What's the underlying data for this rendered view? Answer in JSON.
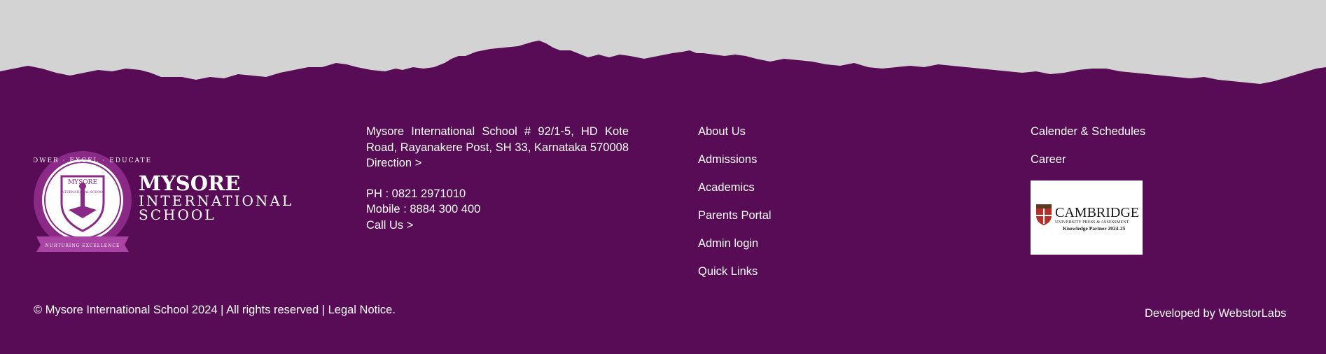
{
  "colors": {
    "footer_bg": "#580c56",
    "page_bg": "#d3d3d3",
    "text": "#ffffff"
  },
  "logo": {
    "name_line1": "MYSORE",
    "name_line2": "INTERNATIONAL",
    "name_line3": "SCHOOL",
    "emblem_top": "EMPOWER · EXCEL · EDUCATE",
    "emblem_shield_title": "MYSORE",
    "emblem_shield_subtitle": "INTERNATIONAL SCHOOL",
    "emblem_ribbon": "NURTURING EXCELLENCE"
  },
  "contact": {
    "address": "Mysore International School # 92/1-5, HD Kote Road, Rayanakere Post, SH 33, Karnataka 570008",
    "direction_link": "Direction >",
    "phone": "PH : 0821 2971010",
    "mobile": "Mobile : 8884 300 400",
    "call_link": "Call Us >"
  },
  "links_col1": [
    "About Us",
    "Admissions",
    "Academics",
    "Parents Portal",
    "Admin login",
    "Quick Links"
  ],
  "links_col2": [
    "Calender & Schedules",
    "Career"
  ],
  "partner": {
    "name": "CAMBRIDGE",
    "subtitle": "UNIVERSITY PRESS & ASSESSMENT",
    "tagline": "Knowledge Partner 2024-25"
  },
  "bottom": {
    "copyright": "© Mysore International School 2024 | All rights reserved | Legal Notice.",
    "developer": "Developed by WebstorLabs"
  }
}
